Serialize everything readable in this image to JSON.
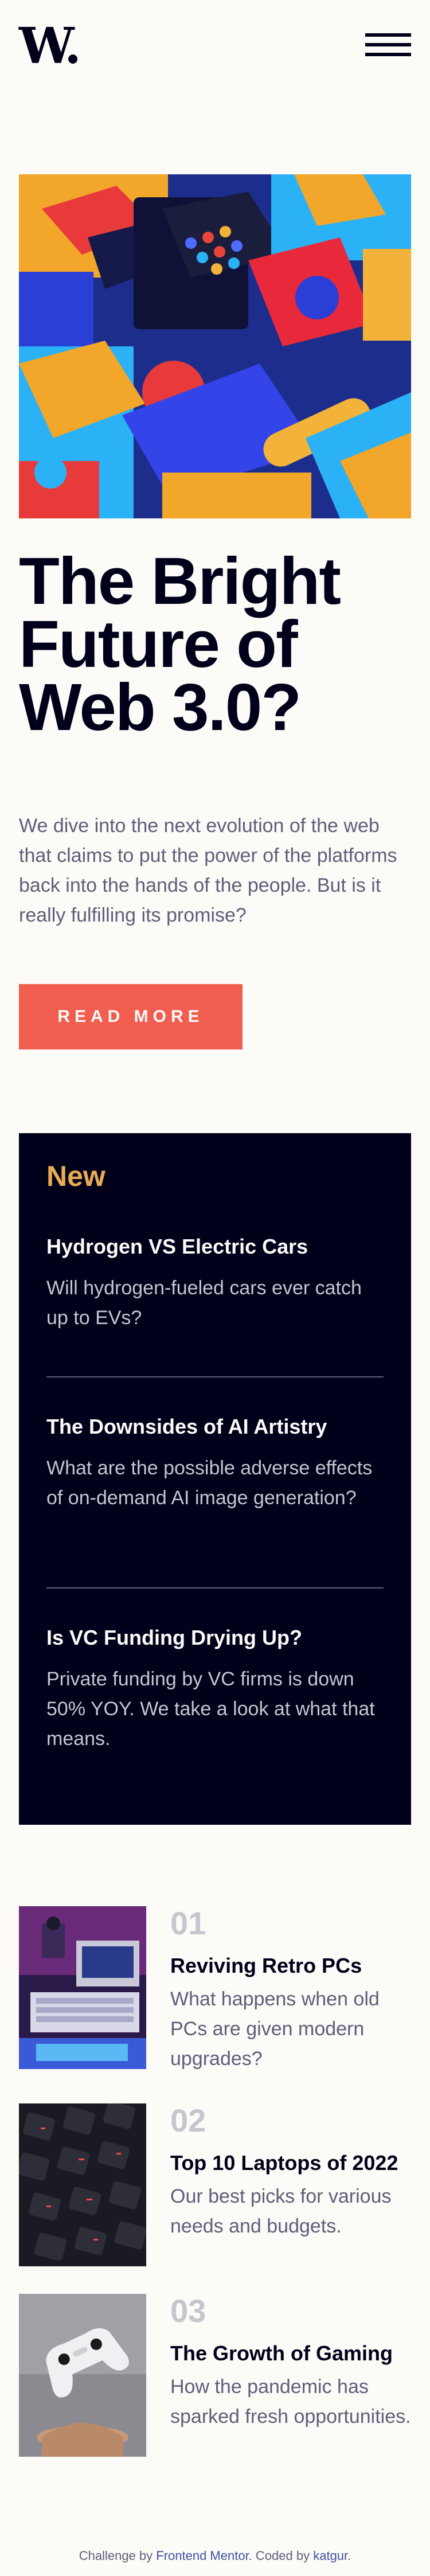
{
  "header": {
    "logo": "W.",
    "menu_icon": "hamburger-menu-icon"
  },
  "hero": {
    "title": "The Bright Future of Web 3.0?",
    "description": "We dive into the next evolution of the web that claims to put the power of the platforms back into the hands of the people. But is it really fulfilling its promise?",
    "button_label": "READ MORE"
  },
  "new_panel": {
    "heading": "New",
    "items": [
      {
        "title": "Hydrogen VS Electric Cars",
        "description": "Will hydrogen-fueled cars ever catch up to EVs?"
      },
      {
        "title": "The Downsides of AI Artistry",
        "description": "What are the possible adverse effects of on-demand AI image generation?"
      },
      {
        "title": "Is VC Funding Drying Up?",
        "description": "Private funding by VC firms is down 50% YOY. We take a look at what that means."
      }
    ]
  },
  "numbered": [
    {
      "number": "01",
      "title": "Reviving Retro PCs",
      "description": "What happens when old PCs are given modern upgrades?"
    },
    {
      "number": "02",
      "title": "Top 10 Laptops of 2022",
      "description": "Our best picks for various needs and budgets."
    },
    {
      "number": "03",
      "title": "The Growth of Gaming",
      "description": "How the pandemic has sparked fresh opportunities."
    }
  ],
  "footer": {
    "prefix": "Challenge by ",
    "link1": "Frontend Mentor",
    "middle": ". Coded by ",
    "author": "katgur",
    "suffix": "."
  },
  "colors": {
    "background": "#fcfbf7",
    "dark": "#00001a",
    "accent_red": "#f15e50",
    "accent_gold": "#e9ab53",
    "muted": "#5d5f79",
    "light_muted": "#c5c6ce"
  }
}
